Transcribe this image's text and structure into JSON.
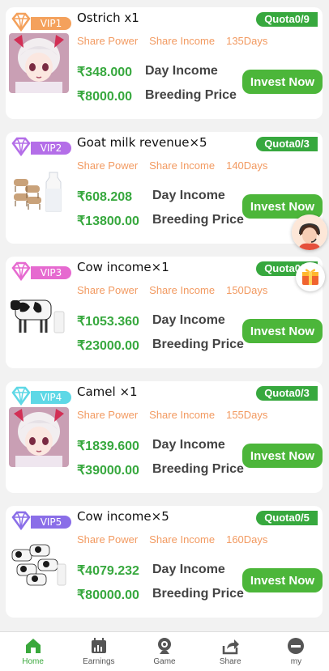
{
  "colors": {
    "accent": "#37a83e",
    "meta": "#f29a61",
    "vip1": "#f4a15c",
    "vip2": "#b46ee8",
    "vip3": "#e66ad0",
    "vip4": "#5ed8e6",
    "vip5": "#8a6ee8"
  },
  "cards": [
    {
      "vip": "VIP1",
      "title": "Ostrich x1",
      "quota": "Quota0/9",
      "share_power": "Share Power",
      "share_income": "Share Income",
      "days": "135Days",
      "day_income_value": "₹348.000",
      "day_income_label": "Day Income",
      "price_value": "₹8000.00",
      "price_label": "Breeding Price",
      "cta": "Invest Now",
      "image": "anime-girl-avatar"
    },
    {
      "vip": "VIP2",
      "title": "Goat milk revenue×5",
      "quota": "Quota0/3",
      "share_power": "Share Power",
      "share_income": "Share Income",
      "days": "140Days",
      "day_income_value": "₹608.208",
      "day_income_label": "Day Income",
      "price_value": "₹13800.00",
      "price_label": "Breeding Price",
      "cta": "Invest Now",
      "image": "goats-and-milk"
    },
    {
      "vip": "VIP3",
      "title": "Cow income×1",
      "quota": "Quota0/1",
      "share_power": "Share Power",
      "share_income": "Share Income",
      "days": "150Days",
      "day_income_value": "₹1053.360",
      "day_income_label": "Day Income",
      "price_value": "₹23000.00",
      "price_label": "Breeding Price",
      "cta": "Invest Now",
      "image": "cow-and-milk"
    },
    {
      "vip": "VIP4",
      "title": "Camel ×1",
      "quota": "Quota0/3",
      "share_power": "Share Power",
      "share_income": "Share Income",
      "days": "155Days",
      "day_income_value": "₹1839.600",
      "day_income_label": "Day Income",
      "price_value": "₹39000.00",
      "price_label": "Breeding Price",
      "cta": "Invest Now",
      "image": "anime-girl-avatar"
    },
    {
      "vip": "VIP5",
      "title": "Cow income×5",
      "quota": "Quota0/5",
      "share_power": "Share Power",
      "share_income": "Share Income",
      "days": "160Days",
      "day_income_value": "₹4079.232",
      "day_income_label": "Day Income",
      "price_value": "₹80000.00",
      "price_label": "Breeding Price",
      "cta": "Invest Now",
      "image": "cows-and-milk"
    }
  ],
  "tabbar": [
    {
      "label": "Home",
      "icon": "home-icon",
      "active": true
    },
    {
      "label": "Earnings",
      "icon": "calendar-chart-icon",
      "active": false
    },
    {
      "label": "Game",
      "icon": "webcam-icon",
      "active": false
    },
    {
      "label": "Share",
      "icon": "share-icon",
      "active": false
    },
    {
      "label": "my",
      "icon": "profile-icon",
      "active": false
    }
  ]
}
